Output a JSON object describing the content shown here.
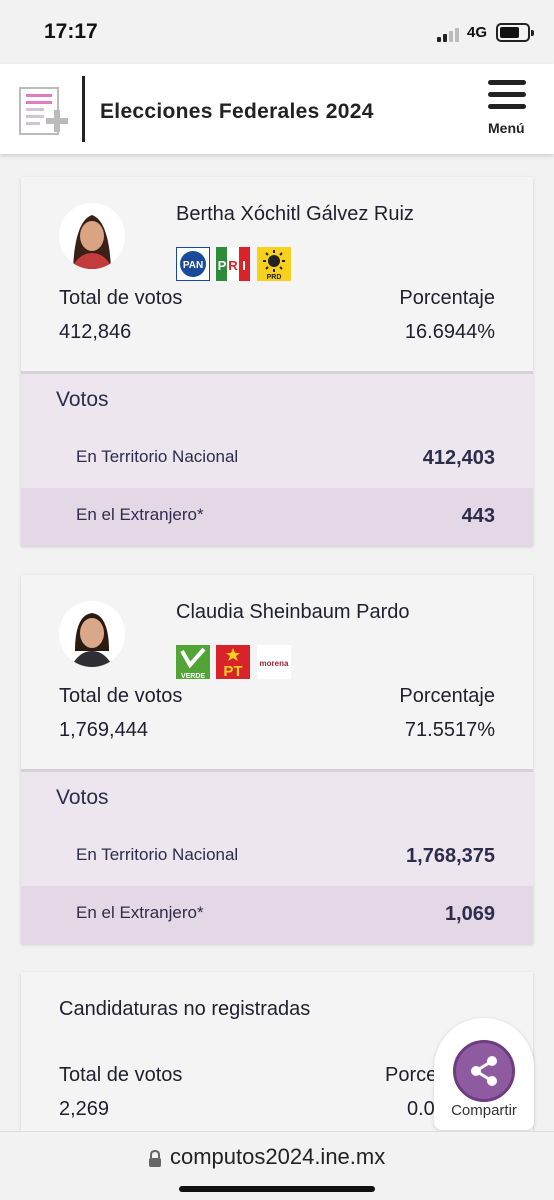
{
  "status": {
    "time": "17:17",
    "network": "4G"
  },
  "header": {
    "title": "Elecciones Federales 2024",
    "menu_label": "Menú"
  },
  "candidates": [
    {
      "name": "Bertha Xóchitl Gálvez Ruiz",
      "parties": [
        "PAN",
        "PRI",
        "PRD"
      ],
      "total_label": "Total de votos",
      "total_value": "412,846",
      "pct_label": "Porcentaje",
      "pct_value": "16.6944%",
      "votos_title": "Votos",
      "rows": [
        {
          "label": "En Territorio Nacional",
          "value": "412,403"
        },
        {
          "label": "En el Extranjero*",
          "value": "443"
        }
      ]
    },
    {
      "name": "Claudia Sheinbaum Pardo",
      "parties": [
        "VERDE",
        "PT",
        "morena"
      ],
      "total_label": "Total de votos",
      "total_value": "1,769,444",
      "pct_label": "Porcentaje",
      "pct_value": "71.5517%",
      "votos_title": "Votos",
      "rows": [
        {
          "label": "En Territorio Nacional",
          "value": "1,768,375"
        },
        {
          "label": "En el Extranjero*",
          "value": "1,069"
        }
      ]
    }
  ],
  "unregistered": {
    "title": "Candidaturas no registradas",
    "total_label": "Total de votos",
    "total_value": "2,269",
    "pct_label": "Porce",
    "pct_value": "0.0"
  },
  "share": {
    "label": "Compartir",
    "icon": "share-icon"
  },
  "browser": {
    "url": "computos2024.ine.mx"
  },
  "colors": {
    "accent": "#8e5aa0",
    "votos_bg": "#ede6ee",
    "votos_alt_row": "#e4d8e6",
    "text": "#2d2d4b"
  }
}
